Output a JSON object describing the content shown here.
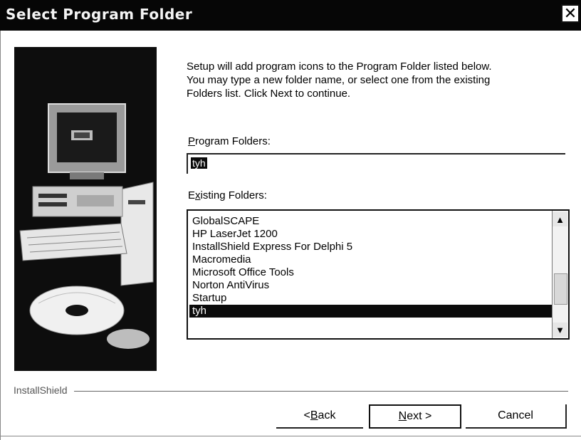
{
  "window": {
    "title": "Select Program Folder",
    "close_symbol": "✕"
  },
  "description": [
    "Setup will add program icons to the Program Folder listed below.",
    "You may type a new folder name, or select one from the existing",
    "Folders list.  Click Next to continue."
  ],
  "program_folders": {
    "label_mnemonic": "P",
    "label_rest": "rogram Folders:",
    "value": "tyh"
  },
  "existing_folders": {
    "label_start": "E",
    "label_mnemonic": "x",
    "label_rest": "isting Folders:",
    "items": [
      "GlobalSCAPE",
      "HP LaserJet 1200",
      "InstallShield Express For Delphi 5",
      "Macromedia",
      "Microsoft Office Tools",
      "Norton AntiVirus",
      "Startup",
      "tyh"
    ],
    "selected": "tyh"
  },
  "footer": {
    "brand": "InstallShield"
  },
  "buttons": {
    "back_prefix": "< ",
    "back_mnemonic": "B",
    "back_rest": "ack",
    "next_mnemonic": "N",
    "next_rest": "ext >",
    "cancel": "Cancel"
  },
  "icons": {
    "close": "close-icon",
    "scroll_up": "chevron-up-icon",
    "scroll_down": "chevron-down-icon"
  }
}
